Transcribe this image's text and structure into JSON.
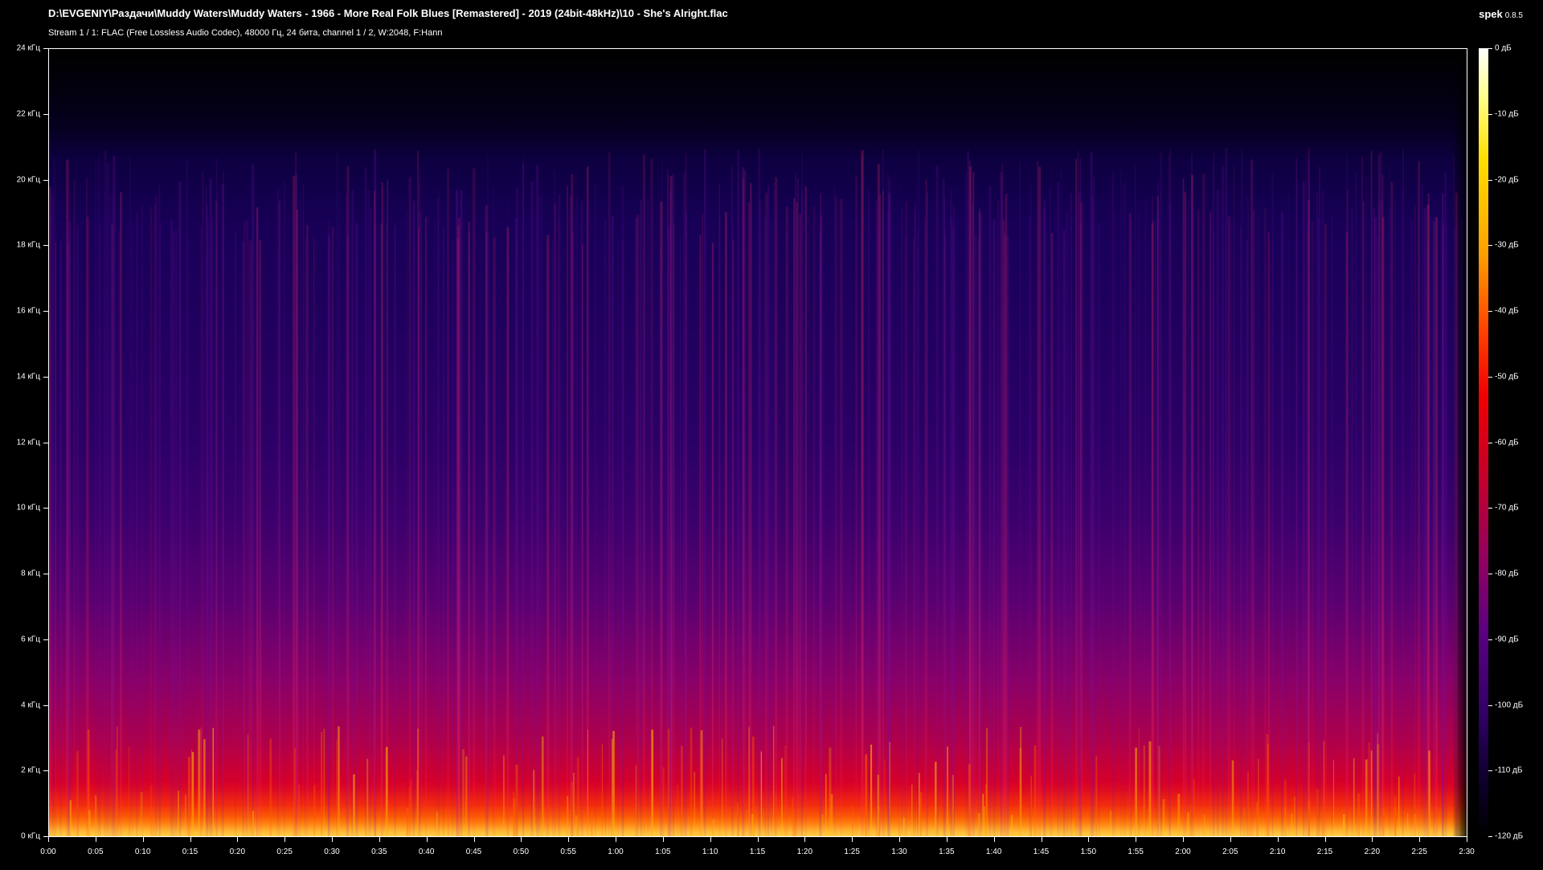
{
  "header": {
    "file_path": "D:\\EVGENIY\\Раздачи\\Muddy Waters\\Muddy Waters - 1966 - More Real Folk Blues [Remastered] - 2019 (24bit-48kHz)\\10 - She's Alright.flac",
    "stream_info": "Stream 1 / 1: FLAC (Free Lossless Audio Codec), 48000 Гц, 24 бита, channel 1 / 2, W:2048, F:Hann",
    "app_name": "spek",
    "app_version": "0.8.5"
  },
  "chart_data": {
    "type": "heatmap",
    "y_ticks": [
      "24 кГц",
      "22 кГц",
      "20 кГц",
      "18 кГц",
      "16 кГц",
      "14 кГц",
      "12 кГц",
      "10 кГц",
      "8 кГц",
      "6 кГц",
      "4 кГц",
      "2 кГц",
      "0 кГц"
    ],
    "y_range_khz": [
      0,
      24
    ],
    "x_ticks": [
      "0:00",
      "0:05",
      "0:10",
      "0:15",
      "0:20",
      "0:25",
      "0:30",
      "0:35",
      "0:40",
      "0:45",
      "0:50",
      "0:55",
      "1:00",
      "1:05",
      "1:10",
      "1:15",
      "1:20",
      "1:25",
      "1:30",
      "1:35",
      "1:40",
      "1:45",
      "1:50",
      "1:55",
      "2:00",
      "2:05",
      "2:10",
      "2:15",
      "2:20",
      "2:25",
      "2:30"
    ],
    "x_range_seconds": [
      0,
      150
    ],
    "colorbar_ticks": [
      "0 дБ",
      "-10 дБ",
      "-20 дБ",
      "-30 дБ",
      "-40 дБ",
      "-50 дБ",
      "-60 дБ",
      "-70 дБ",
      "-80 дБ",
      "-90 дБ",
      "-100 дБ",
      "-110 дБ",
      "-120 дБ"
    ],
    "colorbar_range_db": [
      -120,
      0
    ],
    "spectral_cutoff_khz": 21,
    "colormap": [
      "#000000",
      "#1a0050",
      "#6a0080",
      "#c0002e",
      "#ff0000",
      "#ff8000",
      "#ffe000",
      "#ffffff"
    ]
  }
}
